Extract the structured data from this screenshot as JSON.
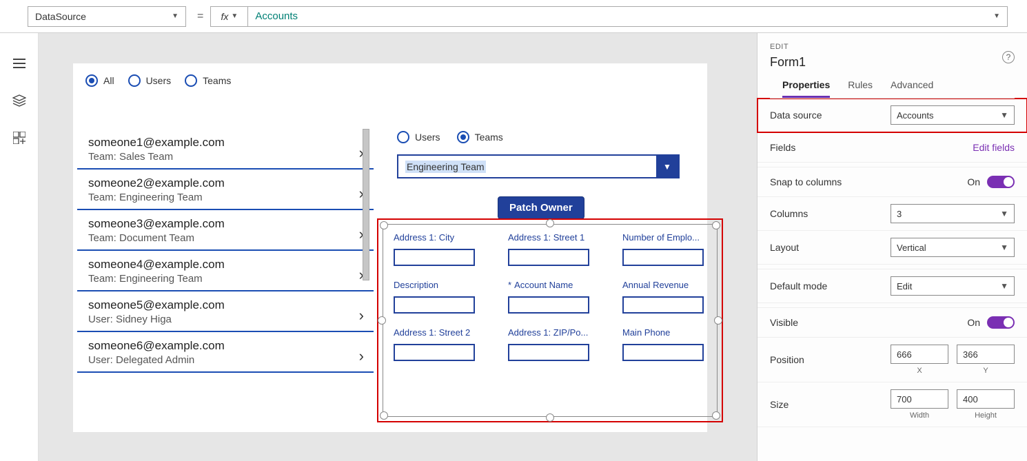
{
  "formulaBar": {
    "property": "DataSource",
    "value": "Accounts"
  },
  "canvas": {
    "filter1": {
      "all": "All",
      "users": "Users",
      "teams": "Teams"
    },
    "filter2": {
      "users": "Users",
      "teams": "Teams"
    },
    "teamDropdown": "Engineering Team",
    "patchBtn": "Patch Owner",
    "list": [
      {
        "email": "someone1@example.com",
        "sub": "Team: Sales Team"
      },
      {
        "email": "someone2@example.com",
        "sub": "Team: Engineering Team"
      },
      {
        "email": "someone3@example.com",
        "sub": "Team: Document Team"
      },
      {
        "email": "someone4@example.com",
        "sub": "Team: Engineering Team"
      },
      {
        "email": "someone5@example.com",
        "sub": "User: Sidney Higa"
      },
      {
        "email": "someone6@example.com",
        "sub": "User: Delegated Admin"
      }
    ],
    "fields": {
      "f1": "Address 1: City",
      "f2": "Address 1: Street 1",
      "f3": "Number of Emplo...",
      "f4": "Description",
      "f5req": "*",
      "f5": "Account Name",
      "f6": "Annual Revenue",
      "f7": "Address 1: Street 2",
      "f8": "Address 1: ZIP/Po...",
      "f9": "Main Phone"
    }
  },
  "props": {
    "editLabel": "EDIT",
    "name": "Form1",
    "tabs": {
      "properties": "Properties",
      "rules": "Rules",
      "advanced": "Advanced"
    },
    "dataSourceLabel": "Data source",
    "dataSourceValue": "Accounts",
    "fieldsLabel": "Fields",
    "editFields": "Edit fields",
    "snapLabel": "Snap to columns",
    "snapValue": "On",
    "columnsLabel": "Columns",
    "columnsValue": "3",
    "layoutLabel": "Layout",
    "layoutValue": "Vertical",
    "defaultModeLabel": "Default mode",
    "defaultModeValue": "Edit",
    "visibleLabel": "Visible",
    "visibleValue": "On",
    "positionLabel": "Position",
    "posX": "666",
    "posXLabel": "X",
    "posY": "366",
    "posYLabel": "Y",
    "sizeLabel": "Size",
    "sizeW": "700",
    "sizeWLabel": "Width",
    "sizeH": "400",
    "sizeHLabel": "Height"
  }
}
